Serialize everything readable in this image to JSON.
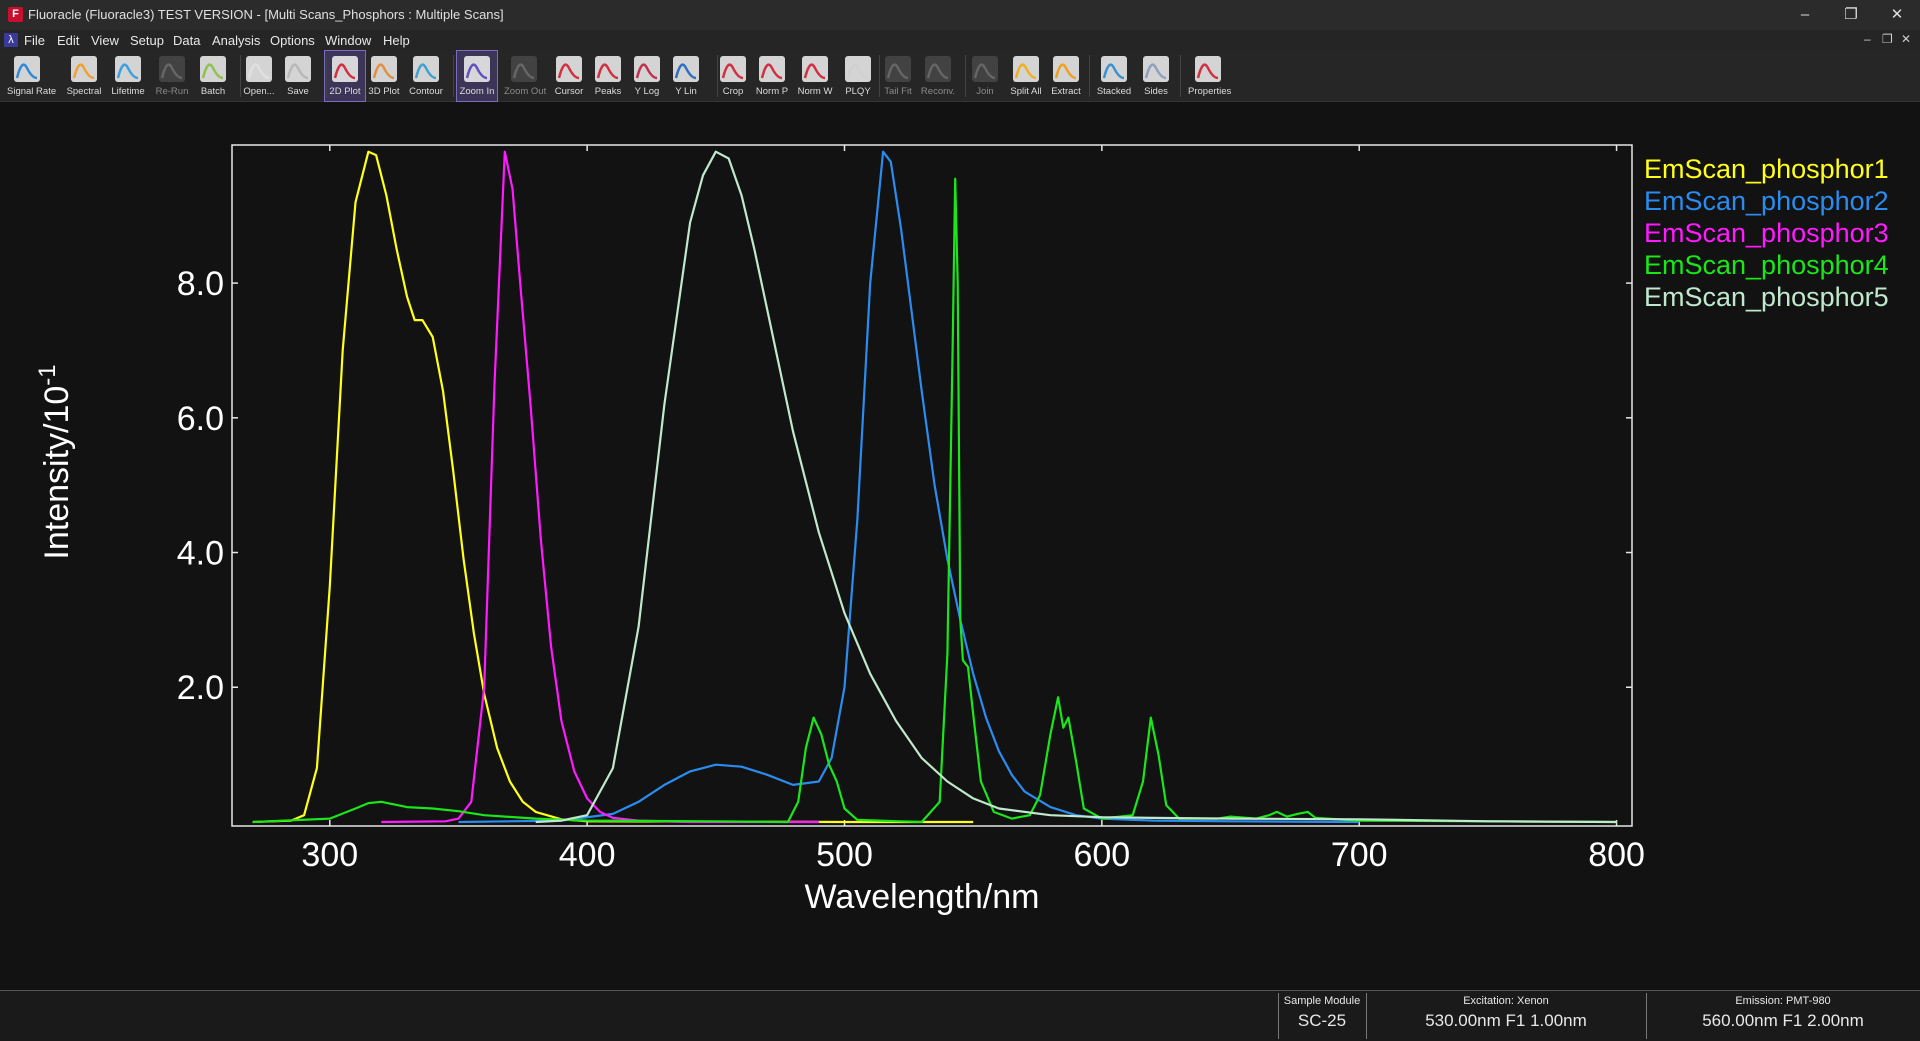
{
  "window": {
    "title": "Fluoracle (Fluoracle3) TEST VERSION - [Multi Scans_Phosphors : Multiple Scans]",
    "icon_letter": "F",
    "minimize": "–",
    "restore": "❐",
    "close": "✕"
  },
  "menu": {
    "items": [
      "File",
      "Edit",
      "View",
      "Setup",
      "Data",
      "Analysis",
      "Options",
      "Window",
      "Help"
    ],
    "mdi_minimize": "–",
    "mdi_restore": "❐",
    "mdi_close": "✕"
  },
  "toolbar": {
    "buttons": [
      {
        "label": "Signal Rate",
        "icon": "signal-rate-icon",
        "enabled": true
      },
      {
        "label": "Spectral",
        "icon": "spectral-icon",
        "enabled": true
      },
      {
        "label": "Lifetime",
        "icon": "lifetime-icon",
        "enabled": true
      },
      {
        "label": "Re-Run",
        "icon": "rerun-icon",
        "enabled": false
      },
      {
        "label": "Batch",
        "icon": "batch-icon",
        "enabled": true
      },
      {
        "label": "Open...",
        "icon": "open-icon",
        "enabled": true
      },
      {
        "label": "Save",
        "icon": "save-icon",
        "enabled": true
      },
      {
        "label": "2D Plot",
        "icon": "plot-2d-icon",
        "enabled": true,
        "active": true
      },
      {
        "label": "3D Plot",
        "icon": "plot-3d-icon",
        "enabled": true
      },
      {
        "label": "Contour",
        "icon": "contour-icon",
        "enabled": true
      },
      {
        "label": "Zoom In",
        "icon": "zoom-in-icon",
        "enabled": true,
        "active": true
      },
      {
        "label": "Zoom Out",
        "icon": "zoom-out-icon",
        "enabled": false
      },
      {
        "label": "Cursor",
        "icon": "cursor-icon",
        "enabled": true
      },
      {
        "label": "Peaks",
        "icon": "peaks-icon",
        "enabled": true
      },
      {
        "label": "Y Log",
        "icon": "y-log-icon",
        "enabled": true
      },
      {
        "label": "Y Lin",
        "icon": "y-lin-icon",
        "enabled": true
      },
      {
        "label": "Crop",
        "icon": "crop-icon",
        "enabled": true
      },
      {
        "label": "Norm P",
        "icon": "norm-p-icon",
        "enabled": true
      },
      {
        "label": "Norm W",
        "icon": "norm-w-icon",
        "enabled": true
      },
      {
        "label": "PLQY",
        "icon": "plqy-icon",
        "enabled": true
      },
      {
        "label": "Tail Fit",
        "icon": "tail-fit-icon",
        "enabled": false
      },
      {
        "label": "Reconv.",
        "icon": "reconv-icon",
        "enabled": false
      },
      {
        "label": "Join",
        "icon": "join-icon",
        "enabled": false
      },
      {
        "label": "Split All",
        "icon": "split-all-icon",
        "enabled": true
      },
      {
        "label": "Extract",
        "icon": "extract-icon",
        "enabled": true
      },
      {
        "label": "Stacked",
        "icon": "stacked-icon",
        "enabled": true
      },
      {
        "label": "Sides",
        "icon": "sides-icon",
        "enabled": true
      },
      {
        "label": "Properties",
        "icon": "properties-icon",
        "enabled": true
      }
    ]
  },
  "chart_data": {
    "type": "line",
    "xlabel": "Wavelength/nm",
    "ylabel": "Intensity/10",
    "ylabel_exponent": "-1",
    "xlim": [
      262,
      806
    ],
    "ylim": [
      -0.06,
      10.05
    ],
    "x_ticks": [
      "300",
      "400",
      "500",
      "600",
      "700",
      "800"
    ],
    "x_tick_values": [
      300,
      400,
      500,
      600,
      700,
      800
    ],
    "y_ticks": [
      "2.0",
      "4.0",
      "6.0",
      "8.0"
    ],
    "y_tick_values": [
      2,
      4,
      6,
      8
    ],
    "grid": false,
    "legend_position": "right",
    "background": "#121212",
    "series": [
      {
        "name": "EmScan_phosphor1",
        "color": "#ffff1a",
        "points": [
          [
            270,
            0
          ],
          [
            285,
            0.02
          ],
          [
            290,
            0.1
          ],
          [
            295,
            0.8
          ],
          [
            300,
            3.5
          ],
          [
            305,
            7.0
          ],
          [
            310,
            9.2
          ],
          [
            315,
            9.95
          ],
          [
            318,
            9.9
          ],
          [
            322,
            9.3
          ],
          [
            326,
            8.5
          ],
          [
            330,
            7.8
          ],
          [
            333,
            7.45
          ],
          [
            336,
            7.45
          ],
          [
            340,
            7.2
          ],
          [
            344,
            6.4
          ],
          [
            348,
            5.2
          ],
          [
            352,
            3.9
          ],
          [
            356,
            2.8
          ],
          [
            360,
            1.9
          ],
          [
            365,
            1.1
          ],
          [
            370,
            0.6
          ],
          [
            375,
            0.3
          ],
          [
            380,
            0.15
          ],
          [
            390,
            0.04
          ],
          [
            400,
            0.01
          ],
          [
            500,
            0
          ],
          [
            550,
            0
          ]
        ]
      },
      {
        "name": "EmScan_phosphor2",
        "color": "#2b8cf0",
        "points": [
          [
            350,
            0
          ],
          [
            390,
            0.02
          ],
          [
            410,
            0.12
          ],
          [
            420,
            0.3
          ],
          [
            430,
            0.55
          ],
          [
            440,
            0.75
          ],
          [
            450,
            0.85
          ],
          [
            460,
            0.82
          ],
          [
            470,
            0.7
          ],
          [
            480,
            0.55
          ],
          [
            490,
            0.6
          ],
          [
            495,
            0.95
          ],
          [
            500,
            2.0
          ],
          [
            505,
            4.5
          ],
          [
            510,
            8.0
          ],
          [
            515,
            9.95
          ],
          [
            518,
            9.8
          ],
          [
            522,
            8.8
          ],
          [
            526,
            7.6
          ],
          [
            530,
            6.4
          ],
          [
            535,
            5.0
          ],
          [
            540,
            3.9
          ],
          [
            545,
            3.0
          ],
          [
            550,
            2.2
          ],
          [
            555,
            1.55
          ],
          [
            560,
            1.05
          ],
          [
            565,
            0.7
          ],
          [
            570,
            0.45
          ],
          [
            580,
            0.22
          ],
          [
            590,
            0.1
          ],
          [
            600,
            0.05
          ],
          [
            620,
            0.02
          ],
          [
            650,
            0.01
          ],
          [
            700,
            0
          ]
        ]
      },
      {
        "name": "EmScan_phosphor3",
        "color": "#ff1aff",
        "points": [
          [
            320,
            0
          ],
          [
            345,
            0.01
          ],
          [
            350,
            0.05
          ],
          [
            355,
            0.3
          ],
          [
            360,
            2.0
          ],
          [
            364,
            6.5
          ],
          [
            368,
            9.95
          ],
          [
            371,
            9.4
          ],
          [
            374,
            8.0
          ],
          [
            378,
            6.2
          ],
          [
            382,
            4.2
          ],
          [
            386,
            2.6
          ],
          [
            390,
            1.5
          ],
          [
            395,
            0.75
          ],
          [
            400,
            0.35
          ],
          [
            405,
            0.15
          ],
          [
            410,
            0.06
          ],
          [
            420,
            0.02
          ],
          [
            440,
            0
          ],
          [
            490,
            0
          ]
        ]
      },
      {
        "name": "EmScan_phosphor4",
        "color": "#1ae61a",
        "points": [
          [
            270,
            0
          ],
          [
            300,
            0.05
          ],
          [
            310,
            0.2
          ],
          [
            315,
            0.28
          ],
          [
            320,
            0.3
          ],
          [
            330,
            0.22
          ],
          [
            340,
            0.2
          ],
          [
            350,
            0.16
          ],
          [
            360,
            0.1
          ],
          [
            380,
            0.05
          ],
          [
            400,
            0.02
          ],
          [
            450,
            0.01
          ],
          [
            478,
            0
          ],
          [
            482,
            0.3
          ],
          [
            485,
            1.1
          ],
          [
            488,
            1.55
          ],
          [
            491,
            1.3
          ],
          [
            494,
            0.85
          ],
          [
            497,
            0.6
          ],
          [
            500,
            0.2
          ],
          [
            505,
            0.03
          ],
          [
            530,
            0
          ],
          [
            537,
            0.3
          ],
          [
            540,
            2.5
          ],
          [
            542,
            7.0
          ],
          [
            543,
            9.55
          ],
          [
            544,
            8.0
          ],
          [
            545,
            3.0
          ],
          [
            546,
            2.4
          ],
          [
            548,
            2.3
          ],
          [
            550,
            1.6
          ],
          [
            553,
            0.6
          ],
          [
            558,
            0.15
          ],
          [
            565,
            0.05
          ],
          [
            572,
            0.1
          ],
          [
            576,
            0.4
          ],
          [
            580,
            1.3
          ],
          [
            583,
            1.85
          ],
          [
            585,
            1.4
          ],
          [
            587,
            1.55
          ],
          [
            590,
            0.9
          ],
          [
            593,
            0.2
          ],
          [
            600,
            0.05
          ],
          [
            612,
            0.1
          ],
          [
            616,
            0.6
          ],
          [
            619,
            1.55
          ],
          [
            622,
            1.0
          ],
          [
            625,
            0.25
          ],
          [
            630,
            0.05
          ],
          [
            645,
            0.05
          ],
          [
            650,
            0.08
          ],
          [
            660,
            0.05
          ],
          [
            665,
            0.1
          ],
          [
            668,
            0.15
          ],
          [
            672,
            0.08
          ],
          [
            676,
            0.12
          ],
          [
            680,
            0.15
          ],
          [
            683,
            0.06
          ],
          [
            700,
            0.02
          ],
          [
            800,
            0
          ]
        ]
      },
      {
        "name": "EmScan_phosphor5",
        "color": "#c0e8cc",
        "points": [
          [
            380,
            0
          ],
          [
            390,
            0.02
          ],
          [
            400,
            0.1
          ],
          [
            410,
            0.8
          ],
          [
            420,
            2.9
          ],
          [
            430,
            6.2
          ],
          [
            440,
            8.9
          ],
          [
            445,
            9.6
          ],
          [
            450,
            9.95
          ],
          [
            455,
            9.85
          ],
          [
            460,
            9.3
          ],
          [
            465,
            8.5
          ],
          [
            470,
            7.6
          ],
          [
            480,
            5.8
          ],
          [
            490,
            4.3
          ],
          [
            500,
            3.1
          ],
          [
            510,
            2.2
          ],
          [
            520,
            1.5
          ],
          [
            530,
            0.95
          ],
          [
            540,
            0.6
          ],
          [
            550,
            0.35
          ],
          [
            560,
            0.2
          ],
          [
            580,
            0.1
          ],
          [
            600,
            0.07
          ],
          [
            620,
            0.06
          ],
          [
            650,
            0.05
          ],
          [
            700,
            0.04
          ],
          [
            750,
            0.01
          ],
          [
            800,
            0
          ]
        ]
      }
    ]
  },
  "status": {
    "sample_module_label": "Sample Module",
    "sample_module_value": "SC-25",
    "excitation_label": "Excitation: Xenon",
    "excitation_value": "530.00nm   F1   1.00nm",
    "emission_label": "Emission: PMT-980",
    "emission_value": "560.00nm   F1   2.00nm"
  }
}
